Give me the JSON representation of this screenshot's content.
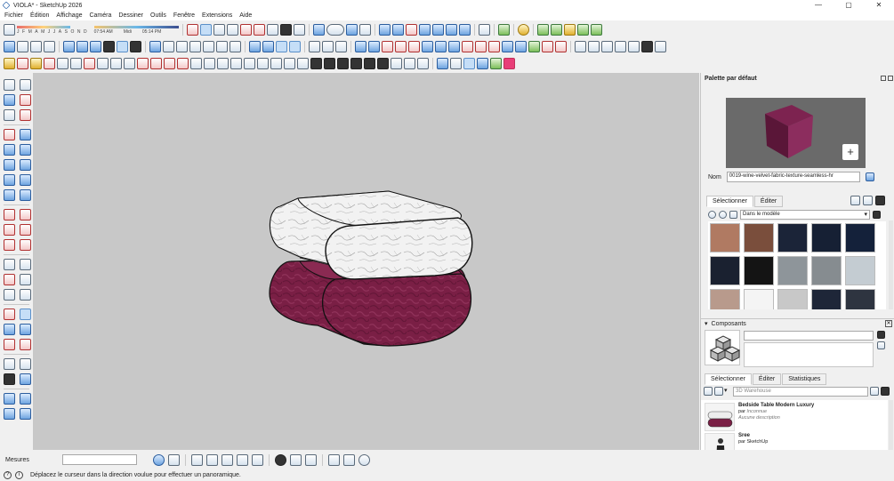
{
  "window": {
    "title": "VIOLA* - SketchUp 2026",
    "minimize": "—",
    "maximize": "▢",
    "close": "✕"
  },
  "menu": [
    "Fichier",
    "Édition",
    "Affichage",
    "Caméra",
    "Dessiner",
    "Outils",
    "Fenêtre",
    "Extensions",
    "Aide"
  ],
  "shadows": {
    "months": [
      "J",
      "F",
      "M",
      "A",
      "M",
      "J",
      "J",
      "A",
      "S",
      "O",
      "N",
      "D"
    ],
    "time_start": "07:54 AM",
    "time_mid": "Midi",
    "time_end": "05:14 PM"
  },
  "tray": {
    "title": "Palette par défaut",
    "materials": {
      "name_label": "Nom",
      "name_value": "0019-wine-velvet-fabric-texture-seamless-hr",
      "tab_select": "Sélectionner",
      "tab_edit": "Éditer",
      "collection": "Dans le modèle",
      "swatches": [
        "#b07a62",
        "#7a4e3c",
        "#1b2438",
        "#162034",
        "#14213a",
        "#1a2130",
        "#141414",
        "#8e959a",
        "#868c90",
        "#c4ccd2",
        "#b89a8c",
        "#f4f4f4",
        "#c8c8c8",
        "#1e2638",
        "#2e3440"
      ]
    },
    "components": {
      "title": "Composants",
      "tab_select": "Sélectionner",
      "tab_edit": "Éditer",
      "tab_stats": "Statistiques",
      "search_placeholder": "3D Warehouse",
      "results": [
        {
          "title": "Bedside Table Modern Luxury",
          "by": "par",
          "author": "Inconnue",
          "desc": "Aucune description"
        },
        {
          "title": "Sree",
          "by": "par",
          "author": "SketchUp",
          "desc": ""
        }
      ]
    }
  },
  "status": {
    "measure_label": "Mesures",
    "hint": "Déplacez le curseur dans la direction voulue pour effectuer un panoramique."
  },
  "colors": {
    "velvet": "#7a1f45",
    "marble": "#f2f2f2",
    "viewport_bg": "#c8c8c8"
  }
}
